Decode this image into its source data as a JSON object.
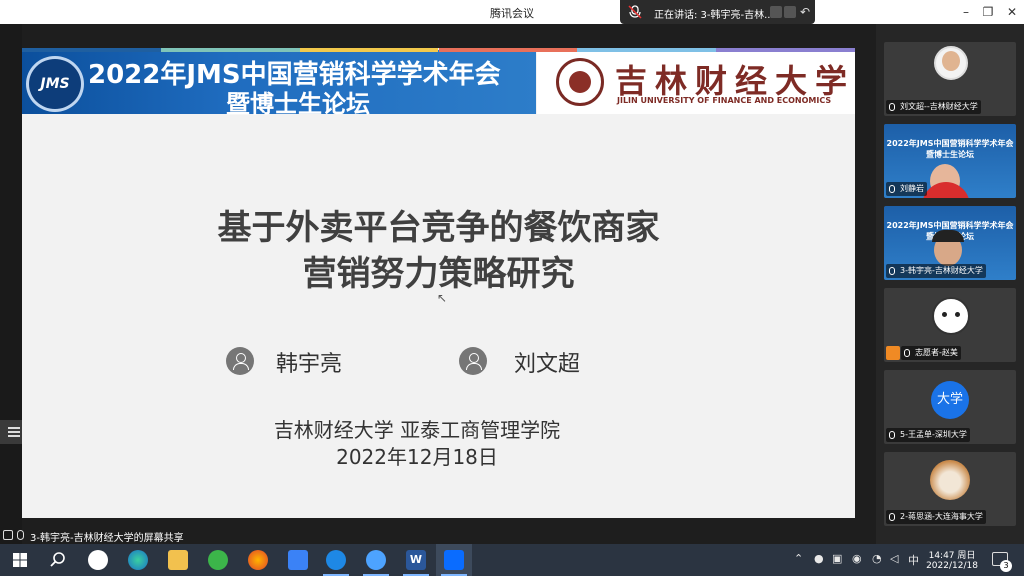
{
  "window": {
    "title": "腾讯会议",
    "speaking": "正在讲话: 3-韩宇亮-吉林...",
    "minimize": "–",
    "restore": "❐",
    "close": "✕"
  },
  "slide": {
    "banner_line1": "2022年JMS中国营销科学学术年会",
    "banner_line2": "暨博士生论坛",
    "jms_logo": "JMS",
    "university_cn": "吉林财经大学",
    "university_en": "JILIN UNIVERSITY OF FINANCE AND ECONOMICS",
    "title_line1": "基于外卖平台竞争的餐饮商家",
    "title_line2": "营销努力策略研究",
    "author1": "韩宇亮",
    "author2": "刘文超",
    "affiliation": "吉林财经大学  亚泰工商管理学院",
    "date": "2022年12月18日",
    "divider_colors": [
      "#1f5fa0",
      "#7fc4b8",
      "#f2c94c",
      "#e8705a",
      "#7fc0e6",
      "#8a7fd0"
    ]
  },
  "share_status": "3-韩宇亮-吉林财经大学的屏幕共享",
  "participants": [
    {
      "label": "刘文超--吉林财经大学",
      "type": "person"
    },
    {
      "label": "刘静岩",
      "type": "slide-person",
      "mini1": "2022年JMS中国营销科学学术年会",
      "mini2": "暨博士生论坛"
    },
    {
      "label": "3-韩宇亮-吉林财经大学",
      "type": "slide-person",
      "mini1": "2022年JMS中国营销科学学术年会",
      "mini2": "暨博士生论坛"
    },
    {
      "label": "志愿者-赵美",
      "type": "avatar-cartoon"
    },
    {
      "label": "5-王孟单-深圳大学",
      "type": "avatar-text",
      "avatar_text": "大学"
    },
    {
      "label": "2-蒋思涵-大连海事大学",
      "type": "avatar-dog"
    }
  ],
  "taskbar": {
    "icons": [
      "windows-start-icon",
      "search-icon",
      "app-icon",
      "edge-icon",
      "folder-icon",
      "refresh-app-icon",
      "firefox-icon",
      "feishu-icon",
      "app-s-icon",
      "app-bird-icon",
      "word-icon",
      "tencent-meeting-icon"
    ],
    "ime": "中",
    "time": "14:47 周日",
    "date": "2022/12/18",
    "notifications": "3"
  }
}
